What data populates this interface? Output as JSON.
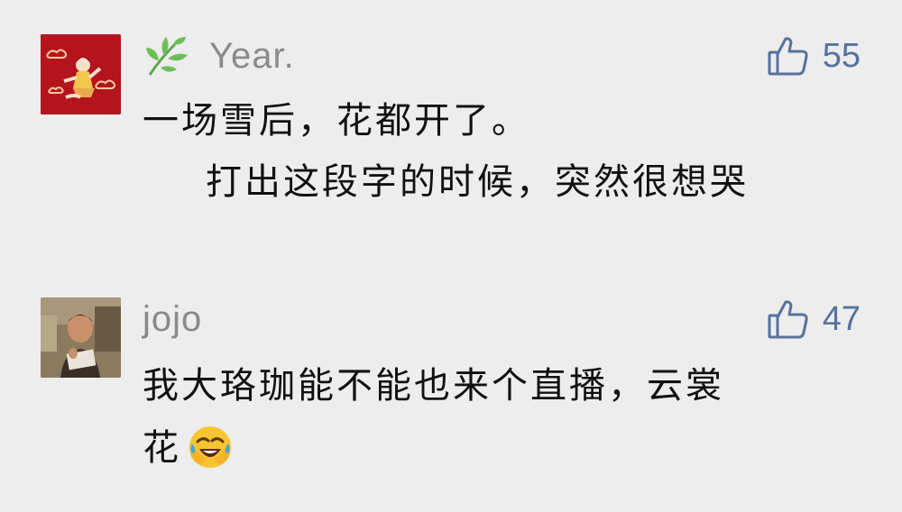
{
  "comments": [
    {
      "username": "Year.",
      "like_count": "55",
      "lines": [
        "一场雪后，花都开了。",
        "打出这段字的时候，突然很想哭"
      ],
      "avatar_icon": "red-cartoon-avatar",
      "badge_icon": "green-leaf-icon"
    },
    {
      "username": "jojo",
      "like_count": "47",
      "lines": [
        "我大珞珈能不能也来个直播，云裳",
        "花"
      ],
      "avatar_icon": "photo-avatar",
      "trailing_emoji": "laughing-crying-emoji"
    }
  ],
  "colors": {
    "background": "#ededed",
    "username": "#8a8a8a",
    "like": "#56729c",
    "text": "#111111"
  }
}
